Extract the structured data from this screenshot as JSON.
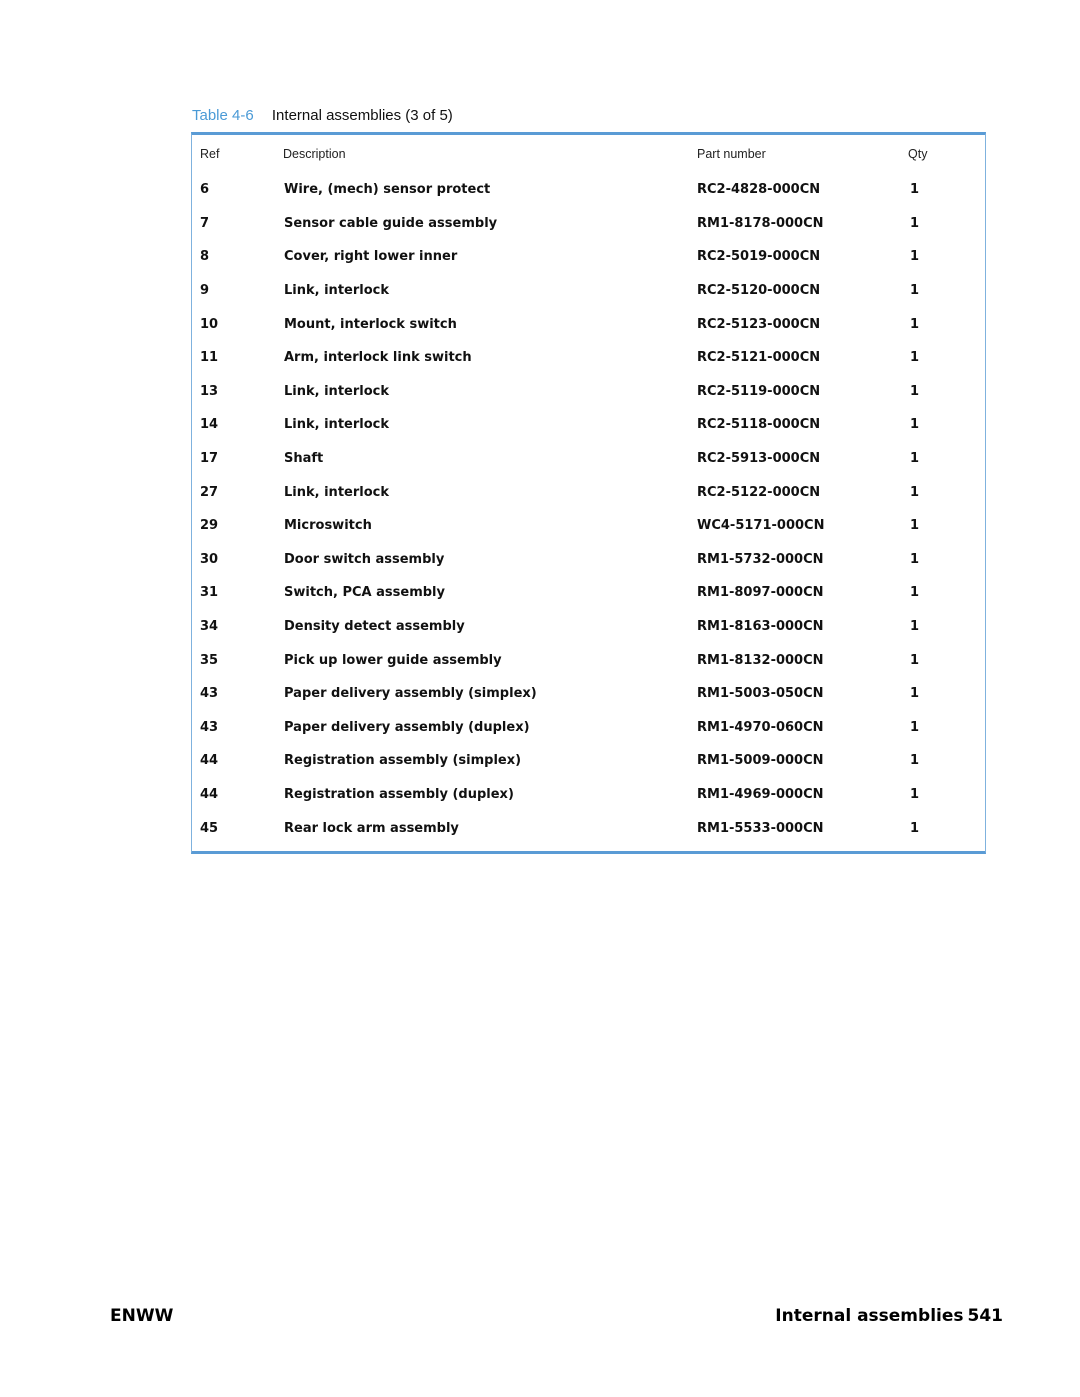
{
  "caption": {
    "label": "Table 4-6",
    "title": "Internal assemblies (3 of 5)"
  },
  "table": {
    "headers": {
      "ref": "Ref",
      "description": "Description",
      "part_number": "Part number",
      "qty": "Qty"
    },
    "rows": [
      {
        "ref": "6",
        "description": "Wire, (mech) sensor protect",
        "part_number": "RC2-4828-000CN",
        "qty": "1"
      },
      {
        "ref": "7",
        "description": "Sensor cable guide assembly",
        "part_number": "RM1-8178-000CN",
        "qty": "1"
      },
      {
        "ref": "8",
        "description": "Cover, right lower inner",
        "part_number": "RC2-5019-000CN",
        "qty": "1"
      },
      {
        "ref": "9",
        "description": "Link, interlock",
        "part_number": "RC2-5120-000CN",
        "qty": "1"
      },
      {
        "ref": "10",
        "description": "Mount, interlock switch",
        "part_number": "RC2-5123-000CN",
        "qty": "1"
      },
      {
        "ref": "11",
        "description": "Arm, interlock link switch",
        "part_number": "RC2-5121-000CN",
        "qty": "1"
      },
      {
        "ref": "13",
        "description": "Link, interlock",
        "part_number": "RC2-5119-000CN",
        "qty": "1"
      },
      {
        "ref": "14",
        "description": "Link, interlock",
        "part_number": "RC2-5118-000CN",
        "qty": "1"
      },
      {
        "ref": "17",
        "description": "Shaft",
        "part_number": "RC2-5913-000CN",
        "qty": "1"
      },
      {
        "ref": "27",
        "description": "Link, interlock",
        "part_number": "RC2-5122-000CN",
        "qty": "1"
      },
      {
        "ref": "29",
        "description": "Microswitch",
        "part_number": "WC4-5171-000CN",
        "qty": "1"
      },
      {
        "ref": "30",
        "description": "Door switch assembly",
        "part_number": "RM1-5732-000CN",
        "qty": "1"
      },
      {
        "ref": "31",
        "description": "Switch, PCA assembly",
        "part_number": "RM1-8097-000CN",
        "qty": "1"
      },
      {
        "ref": "34",
        "description": "Density detect assembly",
        "part_number": "RM1-8163-000CN",
        "qty": "1"
      },
      {
        "ref": "35",
        "description": "Pick up lower guide assembly",
        "part_number": "RM1-8132-000CN",
        "qty": "1"
      },
      {
        "ref": "43",
        "description": "Paper delivery assembly (simplex)",
        "part_number": "RM1-5003-050CN",
        "qty": "1"
      },
      {
        "ref": "43",
        "description": "Paper delivery assembly (duplex)",
        "part_number": "RM1-4970-060CN",
        "qty": "1"
      },
      {
        "ref": "44",
        "description": "Registration assembly (simplex)",
        "part_number": "RM1-5009-000CN",
        "qty": "1"
      },
      {
        "ref": "44",
        "description": "Registration assembly (duplex)",
        "part_number": "RM1-4969-000CN",
        "qty": "1"
      },
      {
        "ref": "45",
        "description": "Rear lock arm assembly",
        "part_number": "RM1-5533-000CN",
        "qty": "1"
      }
    ]
  },
  "footer": {
    "left": "ENWW",
    "section": "Internal assemblies",
    "page_number": "541"
  },
  "colors": {
    "accent": "#4a9ad6",
    "table_border": "#5a9bd5"
  }
}
